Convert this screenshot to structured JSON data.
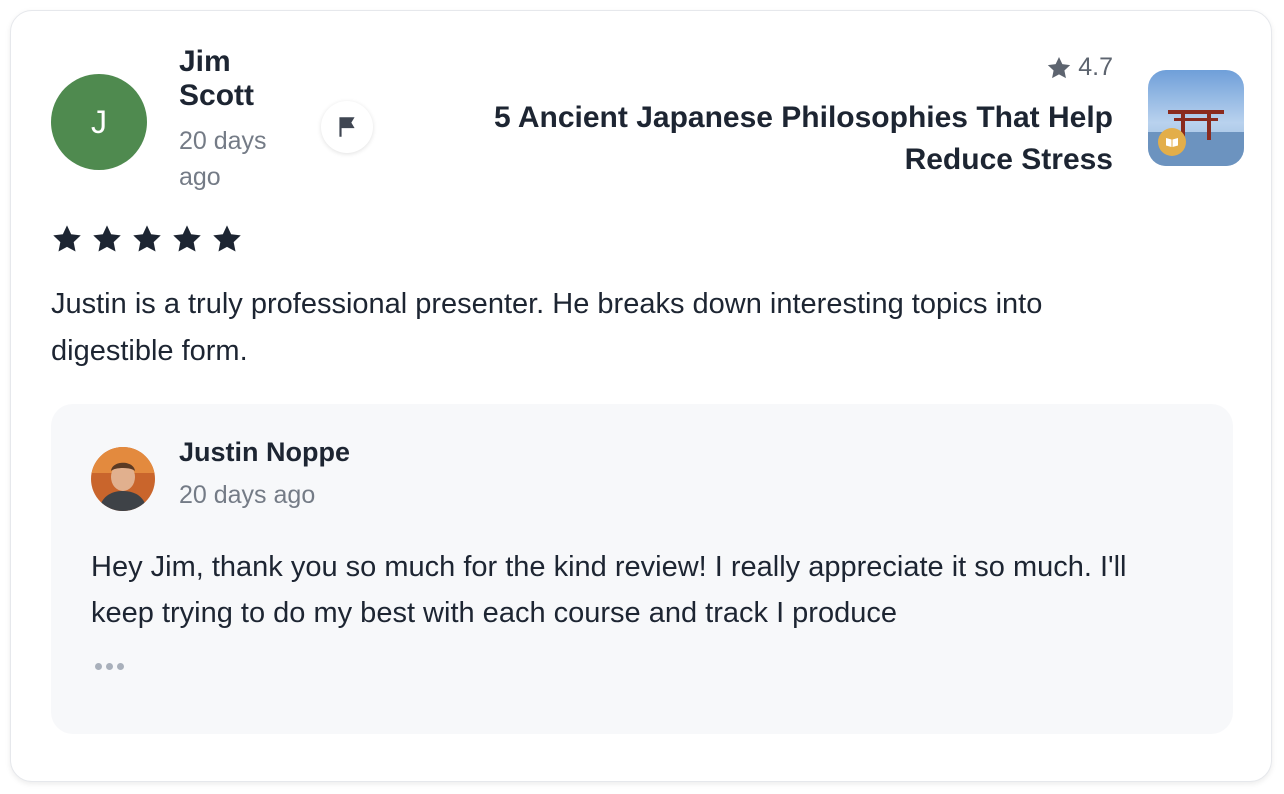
{
  "review": {
    "reviewer_initial": "J",
    "reviewer_name": "Jim Scott",
    "time_ago": "20 days ago",
    "rating_stars": 5,
    "text": "Justin is a truly professional presenter. He breaks down interesting topics into digestible form."
  },
  "course": {
    "rating": "4.7",
    "title": "5 Ancient Japanese Philosophies That Help Reduce Stress"
  },
  "reply": {
    "author_name": "Justin Noppe",
    "time_ago": "20 days ago",
    "text": "Hey Jim, thank you so much for the kind review! I really appreciate it so much. I'll keep trying to do my best with each course and track I produce"
  },
  "icons": {
    "flag": "flag-icon",
    "rating_star": "star-icon",
    "more": "more-dots-icon",
    "badge": "book-icon"
  },
  "colors": {
    "avatar_bg": "#4f8a4f",
    "star_fill": "#1d2532",
    "badge_bg": "#e3ae4a",
    "reply_bg": "#f7f8fa"
  }
}
